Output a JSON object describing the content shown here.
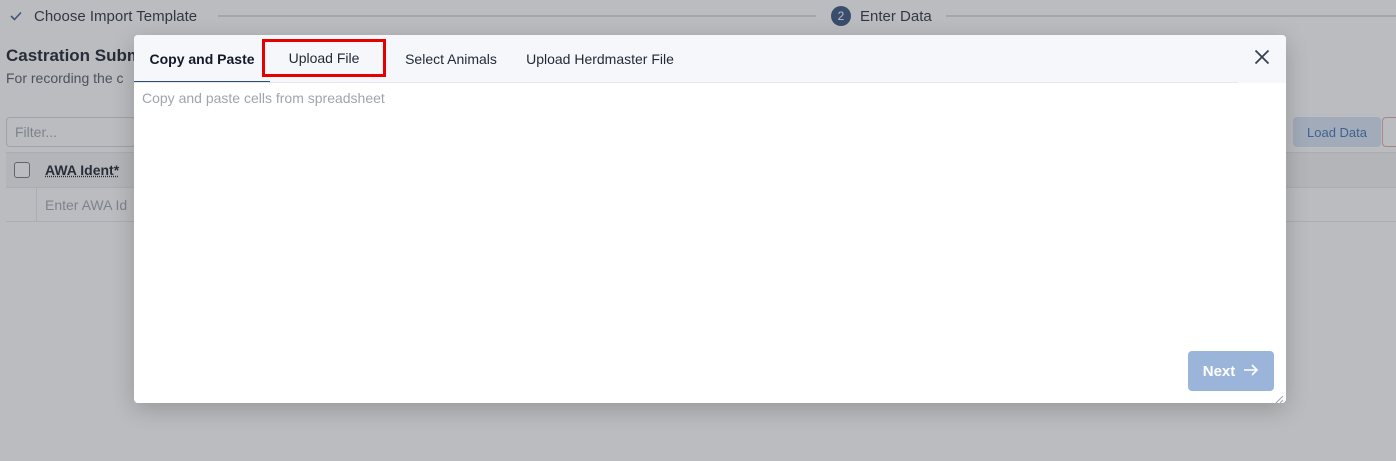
{
  "stepper": {
    "step1_label": "Choose Import Template",
    "step2_number": "2",
    "step2_label": "Enter Data"
  },
  "background": {
    "title": "Castration Subm",
    "subtitle": "For recording the c",
    "filter_placeholder": "Filter...",
    "load_button": "Load Data",
    "table_header": "AWA Ident*",
    "row_placeholder": "Enter AWA Id"
  },
  "modal": {
    "tabs": [
      {
        "label": "Copy and Paste",
        "active": true
      },
      {
        "label": "Upload File",
        "highlighted": true
      },
      {
        "label": "Select Animals"
      },
      {
        "label": "Upload Herdmaster File"
      }
    ],
    "paste_placeholder": "Copy and paste cells from spreadsheet",
    "next_button": "Next"
  },
  "colors": {
    "accent": "#2f4d7a",
    "highlight_box": "#e60000",
    "next_button_bg": "#9bb5da"
  },
  "icons": {
    "close": "close-icon",
    "check": "check-icon",
    "arrow": "arrow-right-icon"
  }
}
